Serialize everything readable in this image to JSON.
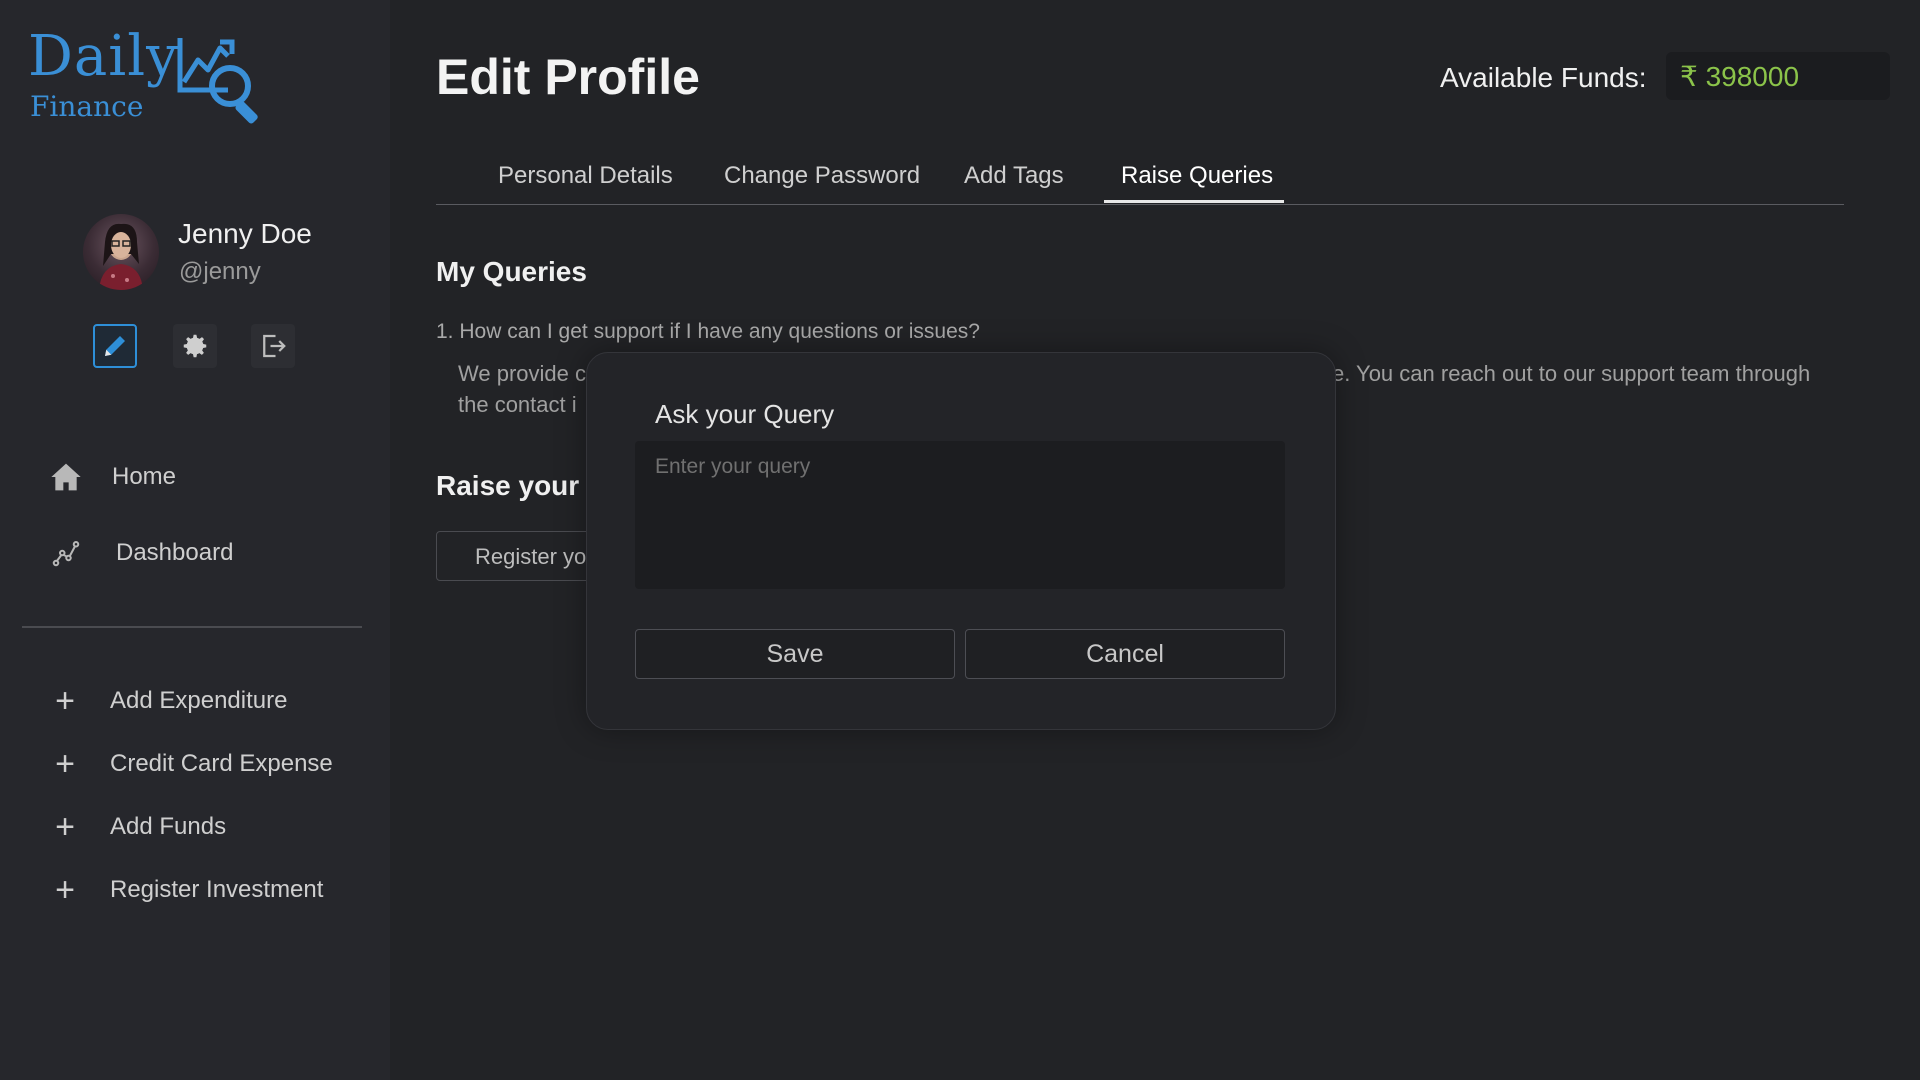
{
  "brand": {
    "name_top": "Daily",
    "name_bottom": "Finance",
    "color": "#3a8fd6"
  },
  "user": {
    "name": "Jenny Doe",
    "handle": "@jenny"
  },
  "profile_actions": [
    {
      "icon": "pencil-icon",
      "active": true
    },
    {
      "icon": "gear-icon",
      "active": false
    },
    {
      "icon": "logout-icon",
      "active": false
    }
  ],
  "nav": [
    {
      "label": "Home",
      "icon": "home-icon"
    },
    {
      "label": "Dashboard",
      "icon": "chart-line-icon"
    }
  ],
  "quick_actions": [
    {
      "label": "Add Expenditure",
      "icon": "plus-icon"
    },
    {
      "label": "Credit Card Expense",
      "icon": "plus-icon"
    },
    {
      "label": "Add Funds",
      "icon": "plus-icon"
    },
    {
      "label": "Register Investment",
      "icon": "plus-icon"
    }
  ],
  "header": {
    "title": "Edit Profile",
    "funds_label": "Available Funds:",
    "funds_value": "₹ 398000",
    "funds_color": "#8bc34a"
  },
  "tabs": [
    {
      "label": "Personal Details",
      "active": false
    },
    {
      "label": "Change Password",
      "active": false
    },
    {
      "label": "Add Tags",
      "active": false
    },
    {
      "label": "Raise Queries",
      "active": true
    }
  ],
  "queries": {
    "heading": "My Queries",
    "question": "1. How can I get support if I have any questions or issues?",
    "answer_visible_start": "We provide c",
    "answer_visible_end": "e. You can reach out to our support team through",
    "answer_line2_visible": "the contact i"
  },
  "raise": {
    "heading_visible": "Raise your c",
    "button_visible": "Register yo"
  },
  "modal": {
    "title": "Ask your Query",
    "placeholder": "Enter your query",
    "value": "",
    "save_label": "Save",
    "cancel_label": "Cancel"
  }
}
